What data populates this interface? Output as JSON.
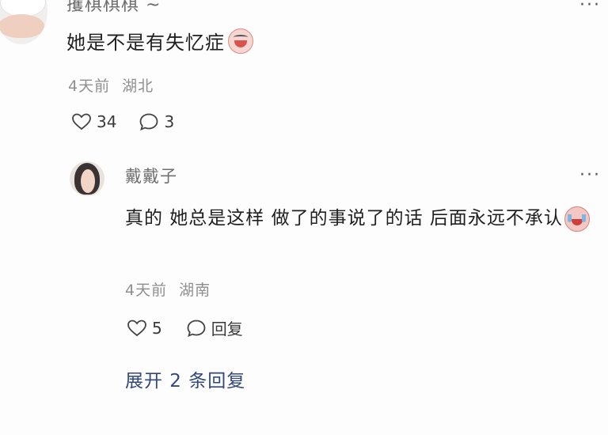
{
  "top_comment": {
    "username": "攫棋棋棋 ~",
    "more_label": "···",
    "text": "她是不是有失忆症",
    "emoji_icon": "crying-face-icon",
    "time": "4天前",
    "location": "湖北",
    "like_count": "34",
    "comment_count": "3"
  },
  "reply": {
    "username": "戴戴子",
    "more_label": "···",
    "text": "真的 她总是这样 做了的事说了的话 后面永远不承认",
    "emoji_icon": "sobbing-face-icon",
    "time": "4天前",
    "location": "湖南",
    "like_count": "5",
    "reply_label": "回复"
  },
  "expand_label": "展开 2 条回复"
}
